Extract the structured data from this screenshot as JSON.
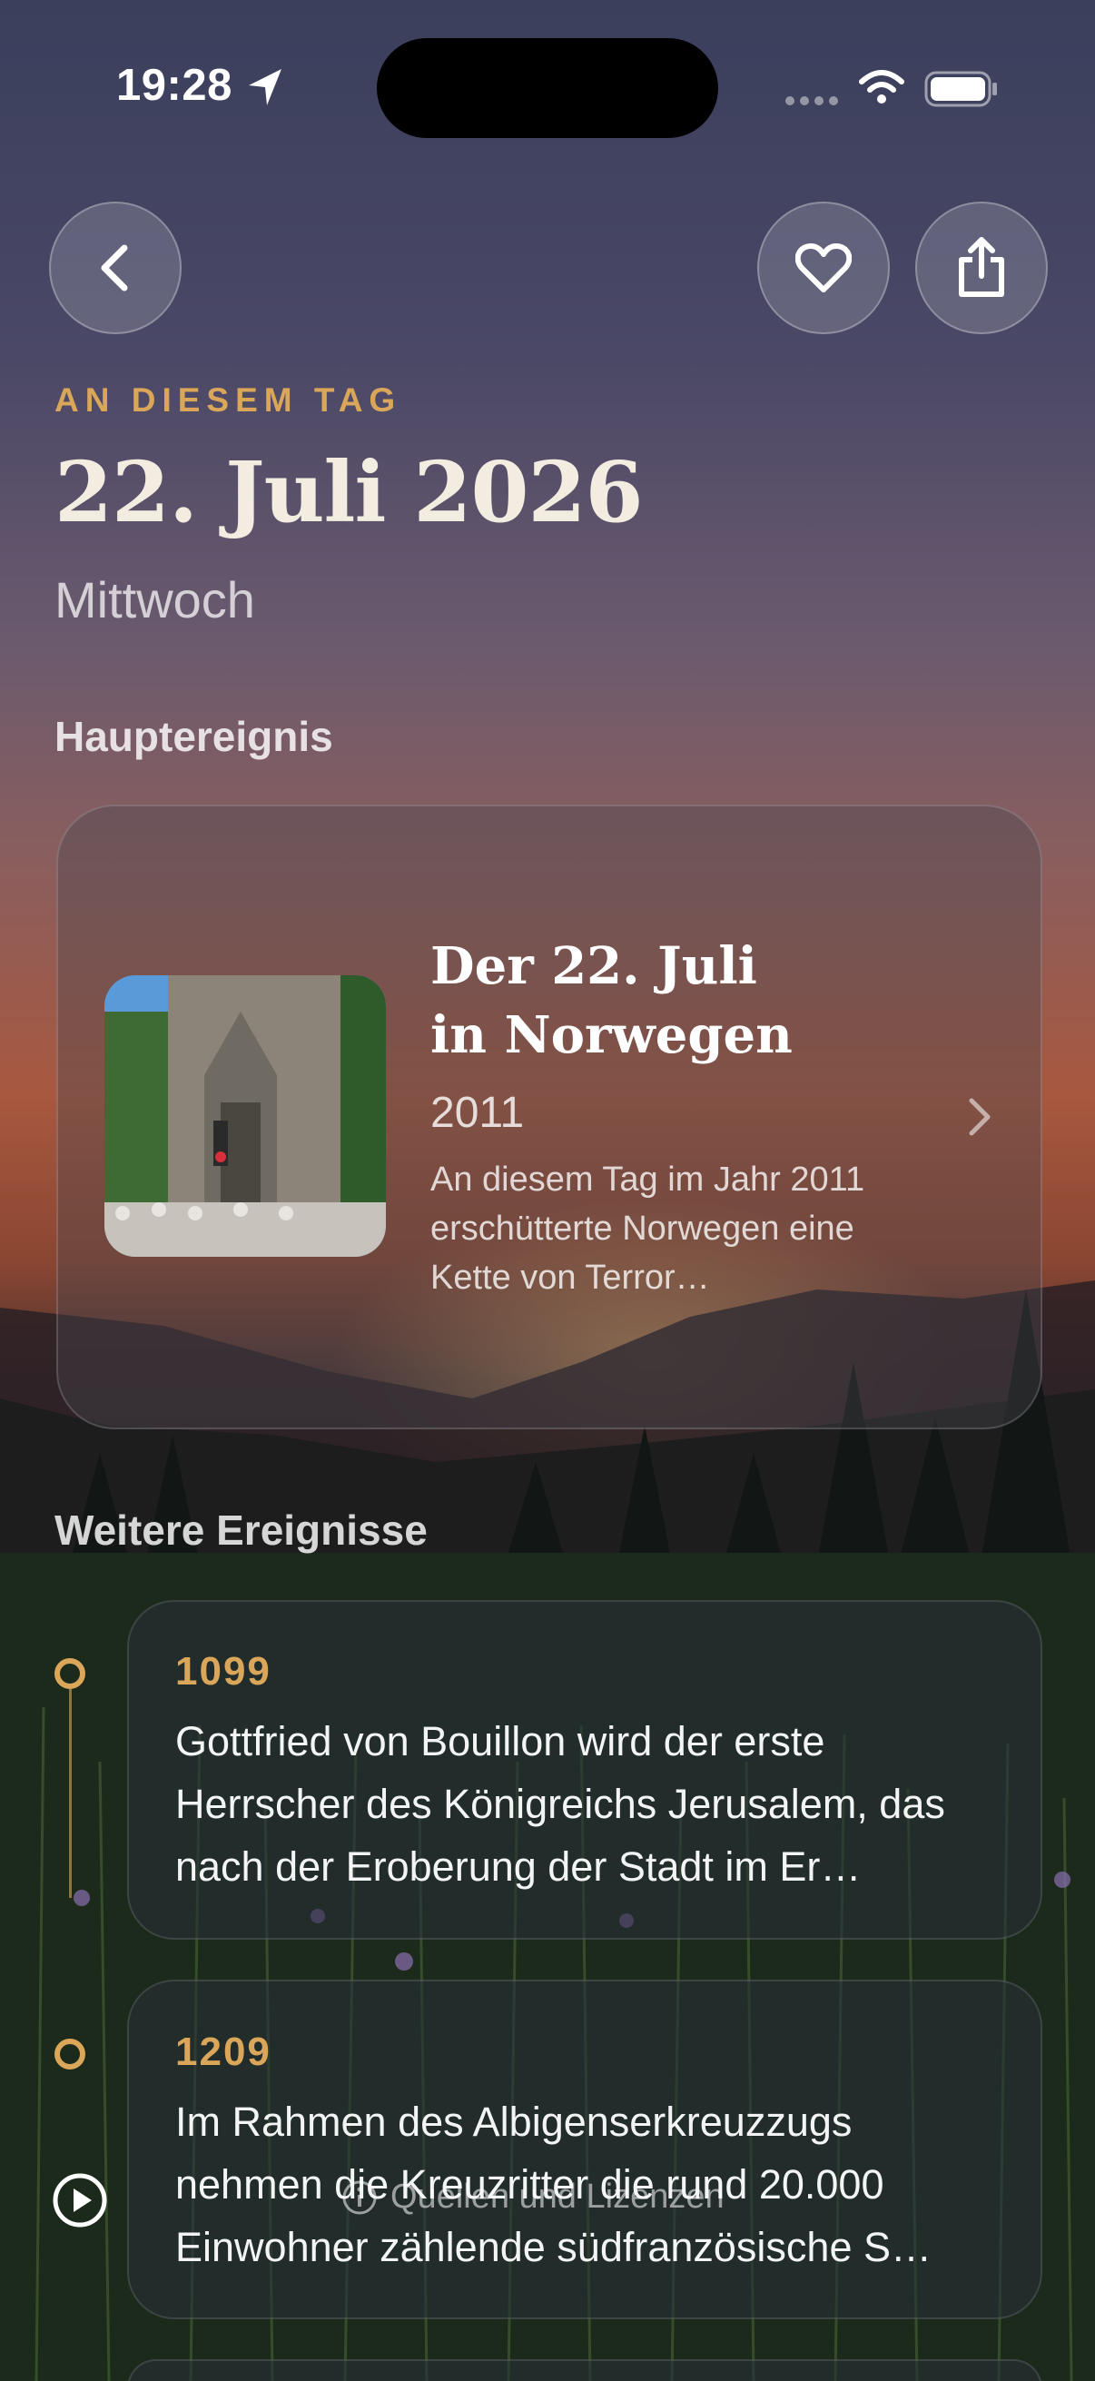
{
  "status_bar": {
    "time": "19:28",
    "location_icon": "location-arrow-icon",
    "signal_icon": "signal-dots-icon",
    "wifi_icon": "wifi-icon",
    "battery_icon": "battery-icon"
  },
  "nav": {
    "back_icon": "chevron-left-icon",
    "favorite_icon": "heart-icon",
    "share_icon": "share-icon"
  },
  "header": {
    "eyebrow": "AN DIESEM TAG",
    "date": "22. Juli 2026",
    "weekday": "Mittwoch"
  },
  "featured": {
    "section_title": "Hauptereignis",
    "title": "Der 22. Juli in Norwegen",
    "year": "2011",
    "description": "An diesem Tag im Jahr 2011 erschütterte Norwe­gen eine Kette von Terror…"
  },
  "more": {
    "section_title": "Weitere Ereignisse",
    "events": [
      {
        "year": "1099",
        "text": "Gottfried von Bouillon wird der erste Herrscher des Königreichs Jerusalem, das nach der Eroberung der Stadt im Er…"
      },
      {
        "year": "1209",
        "text": "Im Rahmen des Albigenserkreuzzugs nehmen die Kreuzritter die rund 20.000 Einwohner zählende südfranzösische S…"
      }
    ]
  },
  "footer": {
    "label": "Quellen und Lizenzen",
    "info_icon": "info-circle-icon",
    "play_icon": "play-circle-icon"
  },
  "colors": {
    "accent": "#d9a65a"
  }
}
